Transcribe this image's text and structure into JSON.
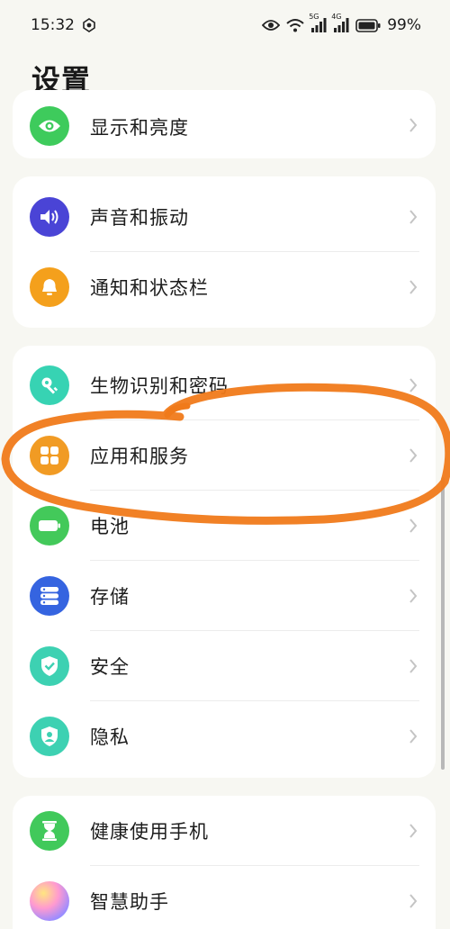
{
  "status_bar": {
    "time": "15:32",
    "battery": "99%",
    "signal1_label": "5G",
    "signal2_label": "4G",
    "icons": [
      "notification-icon",
      "eye-icon",
      "wifi-icon",
      "signal-icon",
      "signal-icon",
      "battery-icon"
    ]
  },
  "page_title": "设置",
  "groups": [
    {
      "items": [
        {
          "label": "显示和亮度",
          "icon": "eye-icon",
          "color": "#3ecb5c"
        }
      ]
    },
    {
      "items": [
        {
          "label": "声音和振动",
          "icon": "speaker-icon",
          "color": "#4a44d6"
        },
        {
          "label": "通知和状态栏",
          "icon": "bell-icon",
          "color": "#f4a01c"
        }
      ]
    },
    {
      "items": [
        {
          "label": "生物识别和密码",
          "icon": "key-icon",
          "color": "#37d3b3"
        },
        {
          "label": "应用和服务",
          "icon": "apps-grid-icon",
          "color": "#f19b24"
        },
        {
          "label": "电池",
          "icon": "battery-icon",
          "color": "#43c95a"
        },
        {
          "label": "存储",
          "icon": "storage-icon",
          "color": "#3564e0"
        },
        {
          "label": "安全",
          "icon": "shield-check-icon",
          "color": "#3dd1b2"
        },
        {
          "label": "隐私",
          "icon": "privacy-shield-icon",
          "color": "#3dd1b2"
        }
      ]
    },
    {
      "items": [
        {
          "label": "健康使用手机",
          "icon": "hourglass-icon",
          "color": "#41c95b"
        },
        {
          "label": "智慧助手",
          "icon": "assistant-orb-icon",
          "color": "#b48cf0"
        }
      ]
    }
  ],
  "annotation_color": "#f07a1a"
}
